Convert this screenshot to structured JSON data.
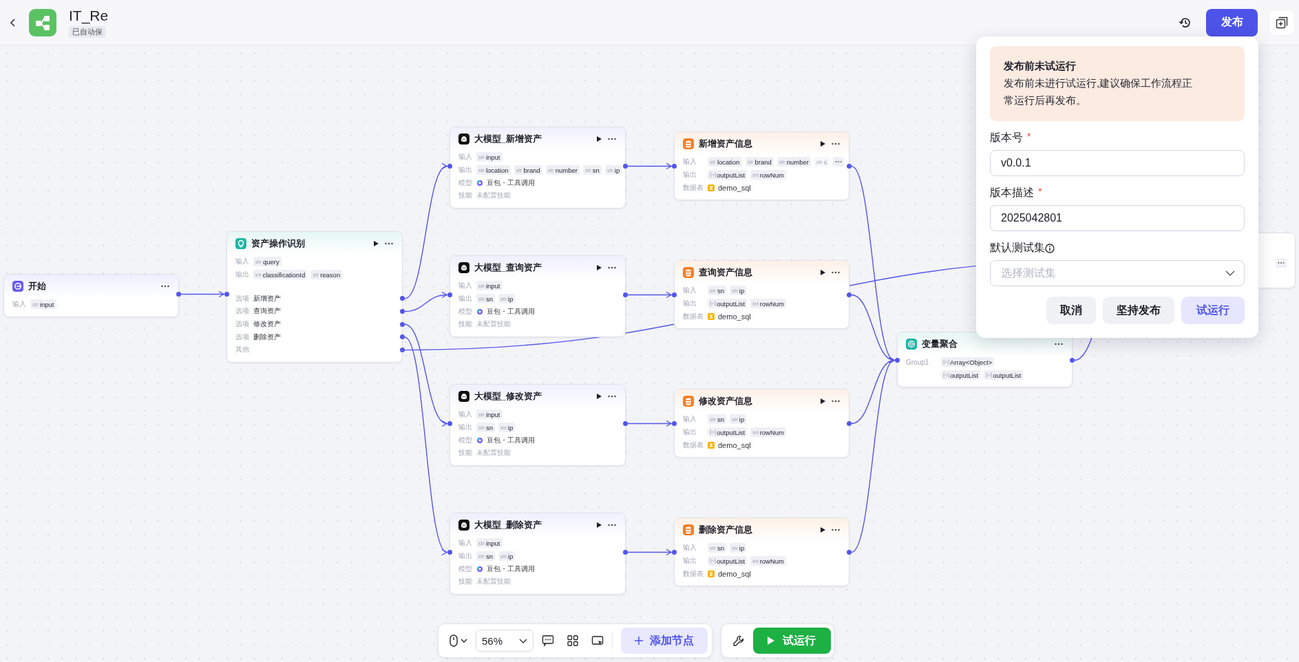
{
  "header": {
    "title": "IT_Re",
    "autosave": "已自动保",
    "publish": "发布"
  },
  "nodes": [
    {
      "kind": "start",
      "title": "开始",
      "rows": [
        {
          "kind": "vars",
          "label": "输入",
          "items": [
            {
              "kind": "typed",
              "type": "str",
              "name": "input"
            }
          ]
        }
      ]
    },
    {
      "kind": "classifier",
      "title": "资产操作识别",
      "rows": [
        {
          "kind": "vars",
          "label": "输入",
          "items": [
            {
              "kind": "typed",
              "type": "str",
              "name": "query"
            }
          ]
        },
        {
          "kind": "vars",
          "label": "输出",
          "items": [
            {
              "kind": "typed",
              "type": "int",
              "name": "classificationId"
            },
            {
              "kind": "typed",
              "type": "str",
              "name": "reason"
            }
          ]
        },
        {
          "kind": "option",
          "label": "选项",
          "text": "新增资产"
        },
        {
          "kind": "option",
          "label": "选项",
          "text": "查询资产"
        },
        {
          "kind": "option",
          "label": "选项",
          "text": "修改资产"
        },
        {
          "kind": "option",
          "label": "选项",
          "text": "删除资产"
        },
        {
          "kind": "option",
          "label": "其他"
        }
      ]
    },
    {
      "kind": "llm",
      "title": "大模型_新增资产",
      "rows": [
        {
          "kind": "vars",
          "label": "输入",
          "items": [
            {
              "kind": "typed",
              "type": "str",
              "name": "input"
            }
          ]
        },
        {
          "kind": "vars",
          "label": "输出",
          "items": [
            {
              "kind": "typed",
              "type": "str",
              "name": "location"
            },
            {
              "kind": "typed",
              "type": "str",
              "name": "brand"
            },
            {
              "kind": "typed",
              "type": "str",
              "name": "number"
            },
            {
              "kind": "typed",
              "type": "str",
              "name": "sn"
            },
            {
              "kind": "typed",
              "type": "str",
              "name": "ip"
            }
          ]
        },
        {
          "kind": "model",
          "label": "模型",
          "text": "豆包・工具调用"
        },
        {
          "kind": "skill",
          "label": "技能",
          "text": "未配置技能"
        }
      ]
    },
    {
      "kind": "llm",
      "title": "大模型_查询资产",
      "rows": [
        {
          "kind": "vars",
          "label": "输入",
          "items": [
            {
              "kind": "typed",
              "type": "str",
              "name": "input"
            }
          ]
        },
        {
          "kind": "vars",
          "label": "输出",
          "items": [
            {
              "kind": "typed",
              "type": "str",
              "name": "sn"
            },
            {
              "kind": "typed",
              "type": "str",
              "name": "ip"
            }
          ]
        },
        {
          "kind": "model",
          "label": "模型",
          "text": "豆包・工具调用"
        },
        {
          "kind": "skill",
          "label": "技能",
          "text": "未配置技能"
        }
      ]
    },
    {
      "kind": "llm",
      "title": "大模型_修改资产",
      "rows": [
        {
          "kind": "vars",
          "label": "输入",
          "items": [
            {
              "kind": "typed",
              "type": "str",
              "name": "input"
            }
          ]
        },
        {
          "kind": "vars",
          "label": "输出",
          "items": [
            {
              "kind": "typed",
              "type": "str",
              "name": "sn"
            },
            {
              "kind": "typed",
              "type": "str",
              "name": "ip"
            }
          ]
        },
        {
          "kind": "model",
          "label": "模型",
          "text": "豆包・工具调用"
        },
        {
          "kind": "skill",
          "label": "技能",
          "text": "未配置技能"
        }
      ]
    },
    {
      "kind": "llm",
      "title": "大模型_删除资产",
      "rows": [
        {
          "kind": "vars",
          "label": "输入",
          "items": [
            {
              "kind": "typed",
              "type": "str",
              "name": "input"
            }
          ]
        },
        {
          "kind": "vars",
          "label": "输出",
          "items": [
            {
              "kind": "typed",
              "type": "str",
              "name": "sn"
            },
            {
              "kind": "typed",
              "type": "str",
              "name": "ip"
            }
          ]
        },
        {
          "kind": "model",
          "label": "模型",
          "text": "豆包・工具调用"
        },
        {
          "kind": "skill",
          "label": "技能",
          "text": "未配置技能"
        }
      ]
    },
    {
      "kind": "database",
      "title": "新增资产信息",
      "rows": [
        {
          "kind": "vars",
          "label": "输入",
          "items": [
            {
              "kind": "typed",
              "type": "str",
              "name": "location",
              "faded": false
            },
            {
              "kind": "typed",
              "type": "str",
              "name": "brand",
              "faded": false
            },
            {
              "kind": "typed",
              "type": "str",
              "name": "number",
              "faded": false
            },
            {
              "kind": "typed",
              "type": "str",
              "name": "s",
              "faded": true
            },
            {
              "kind": "more"
            }
          ]
        },
        {
          "kind": "vars",
          "label": "输出",
          "items": [
            {
              "kind": "array",
              "name": "outputList"
            },
            {
              "kind": "typed",
              "type": "int",
              "name": "rowNum"
            }
          ]
        },
        {
          "kind": "table",
          "label": "数据表",
          "text": "demo_sql"
        }
      ]
    },
    {
      "kind": "database",
      "title": "查询资产信息",
      "rows": [
        {
          "kind": "vars",
          "label": "输入",
          "items": [
            {
              "kind": "typed",
              "type": "str",
              "name": "sn"
            },
            {
              "kind": "typed",
              "type": "str",
              "name": "ip"
            }
          ]
        },
        {
          "kind": "vars",
          "label": "输出",
          "items": [
            {
              "kind": "array",
              "name": "outputList"
            },
            {
              "kind": "typed",
              "type": "int",
              "name": "rowNum"
            }
          ]
        },
        {
          "kind": "table",
          "label": "数据表",
          "text": "demo_sql"
        }
      ]
    },
    {
      "kind": "database",
      "title": "修改资产信息",
      "rows": [
        {
          "kind": "vars",
          "label": "输入",
          "items": [
            {
              "kind": "typed",
              "type": "str",
              "name": "sn"
            },
            {
              "kind": "typed",
              "type": "str",
              "name": "ip"
            }
          ]
        },
        {
          "kind": "vars",
          "label": "输出",
          "items": [
            {
              "kind": "array",
              "name": "outputList"
            },
            {
              "kind": "typed",
              "type": "int",
              "name": "rowNum"
            }
          ]
        },
        {
          "kind": "table",
          "label": "数据表",
          "text": "demo_sql"
        }
      ]
    },
    {
      "kind": "database",
      "title": "删除资产信息",
      "rows": [
        {
          "kind": "vars",
          "label": "输入",
          "items": [
            {
              "kind": "typed",
              "type": "str",
              "name": "sn"
            },
            {
              "kind": "typed",
              "type": "str",
              "name": "ip"
            }
          ]
        },
        {
          "kind": "vars",
          "label": "输出",
          "items": [
            {
              "kind": "array",
              "name": "outputList"
            },
            {
              "kind": "typed",
              "type": "int",
              "name": "rowNum"
            }
          ]
        },
        {
          "kind": "table",
          "label": "数据表",
          "text": "demo_sql"
        }
      ]
    },
    {
      "kind": "aggregate",
      "title": "变量聚合",
      "rows": [
        {
          "kind": "vars",
          "label": "Group1",
          "items": [
            {
              "kind": "array",
              "name": "Array<Object>"
            }
          ]
        },
        {
          "kind": "vars",
          "items": [
            {
              "kind": "array",
              "name": "outputList"
            },
            {
              "kind": "array",
              "name": "outputList"
            }
          ]
        }
      ]
    },
    {
      "kind": "end",
      "rows": [
        {
          "kind": "vars",
          "items": [
            {
              "kind": "more"
            }
          ]
        }
      ]
    }
  ],
  "publish_dialog": {
    "warning_title": "发布前未试运行",
    "warning_text": "发布前未进行试运行,建议确保工作流程正常运行后再发布。",
    "fields": [
      {
        "kind": "input",
        "label": "版本号",
        "required_mark": "*",
        "value": "v0.0.1"
      },
      {
        "kind": "input",
        "label": "版本描述",
        "required_mark": "*",
        "value": "2025042801"
      },
      {
        "kind": "select",
        "label": "默认测试集",
        "info": true,
        "placeholder": "选择测试集"
      }
    ],
    "buttons": [
      {
        "label": "取消",
        "primary": false
      },
      {
        "label": "坚持发布",
        "primary": false
      },
      {
        "label": "试运行",
        "primary": true
      }
    ]
  },
  "toolbar": {
    "zoom": "56%",
    "add_node": "添加节点",
    "test_run": "试运行"
  }
}
